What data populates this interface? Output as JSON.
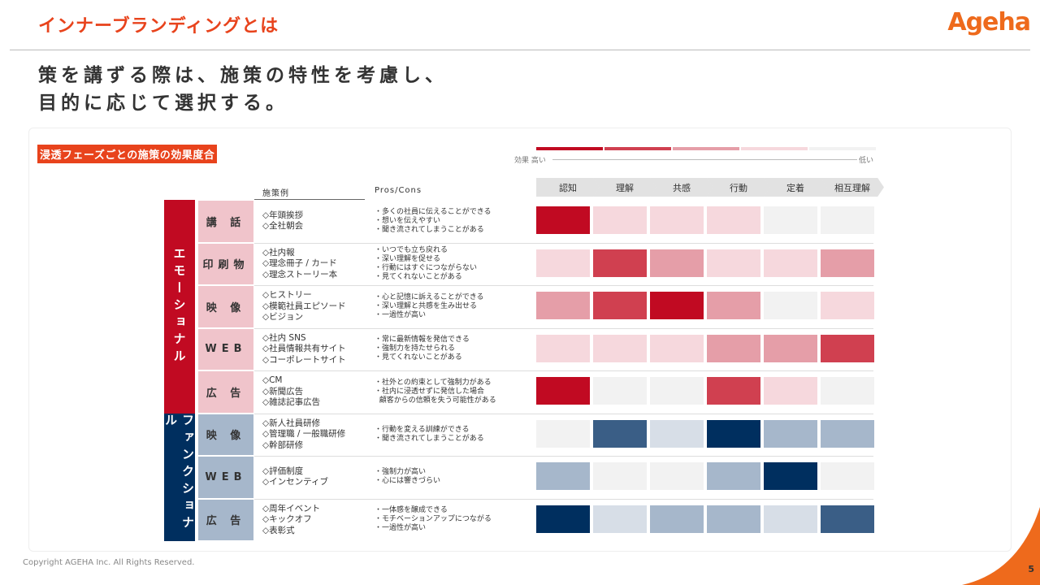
{
  "header": {
    "title": "インナーブランディングとは",
    "logo": "Ageha"
  },
  "headline": {
    "line1": "策を講ずる際は、施策の特性を考慮し、",
    "line2": "目的に応じて選択する。"
  },
  "section_tag": "浸透フェーズごとの施策の効果度合",
  "legend": {
    "high": "効果 高い",
    "low": "低い"
  },
  "columns": {
    "examples": "施策例",
    "pros": "Pros/Cons"
  },
  "phases": [
    "認知",
    "理解",
    "共感",
    "行動",
    "定着",
    "相互理解"
  ],
  "groups": [
    {
      "label": "エモーショナル"
    },
    {
      "label": "ファンクショナル"
    }
  ],
  "rows": [
    {
      "label": "講 話",
      "examples": [
        "◇年頭挨拶",
        "◇全社朝会"
      ],
      "pros": [
        "・多くの社員に伝えることができる",
        "・想いを伝えやすい",
        "・聞き流されてしまうことがある"
      ]
    },
    {
      "label": "印刷物",
      "examples": [
        "◇社内報",
        "◇理念冊子 / カード",
        "◇理念ストーリー本"
      ],
      "pros": [
        "・いつでも立ち戻れる",
        "・深い理解を促せる",
        "・行動にはすぐにつながらない",
        "・見てくれないことがある"
      ]
    },
    {
      "label": "映 像",
      "examples": [
        "◇ヒストリー",
        "◇模範社員エピソード",
        "◇ビジョン"
      ],
      "pros": [
        "・心と記憶に訴えることができる",
        "・深い理解と共感を生み出せる",
        "・一過性が高い"
      ]
    },
    {
      "label": "WEB",
      "examples": [
        "◇社内 SNS",
        "◇社員情報共有サイト",
        "◇コーポレートサイト"
      ],
      "pros": [
        "・常に最新情報を発信できる",
        "・強制力を持たせられる",
        "・見てくれないことがある"
      ]
    },
    {
      "label": "広 告",
      "examples": [
        "◇CM",
        "◇新聞広告",
        "◇雑誌記事広告"
      ],
      "pros": [
        "・社外との約束として強制力がある",
        "・社内に浸透せずに発信した場合",
        "  顧客からの信頼を失う可能性がある"
      ]
    },
    {
      "label": "映 像",
      "examples": [
        "◇新人社員研修",
        "◇管理職 / 一般職研修",
        "◇幹部研修"
      ],
      "pros": [
        "・行動を変える訓練ができる",
        "・聞き流されてしまうことがある"
      ]
    },
    {
      "label": "WEB",
      "examples": [
        "◇評価制度",
        "◇インセンティブ"
      ],
      "pros": [
        "・強制力が高い",
        "・心には響きづらい"
      ]
    },
    {
      "label": "広 告",
      "examples": [
        "◇周年イベント",
        "◇キックオフ",
        "◇表彰式"
      ],
      "pros": [
        "・一体感を醸成できる",
        "・モチベーションアップにつながる",
        "・一過性が高い"
      ]
    }
  ],
  "colors": {
    "red": [
      "#c10a22",
      "#d04050",
      "#e59ea8",
      "#f6d8dd",
      "#f2f2f2"
    ],
    "blue": [
      "#002f5f",
      "#3a5e86",
      "#a6b7cb",
      "#d7dee7",
      "#f2f2f2"
    ],
    "emotional_bar": "#c10a22",
    "functional_bar": "#002f5f",
    "emotional_label": "#f0c4cb",
    "functional_label": "#a6b7cb"
  },
  "effect_levels": [
    [
      1,
      4,
      4,
      4,
      5,
      5
    ],
    [
      4,
      2,
      3,
      4,
      4,
      3
    ],
    [
      3,
      2,
      1,
      3,
      5,
      4
    ],
    [
      4,
      4,
      4,
      3,
      3,
      2
    ],
    [
      1,
      5,
      5,
      2,
      4,
      5
    ],
    [
      5,
      2,
      4,
      1,
      3,
      3
    ],
    [
      3,
      5,
      5,
      3,
      1,
      5
    ],
    [
      1,
      4,
      3,
      3,
      4,
      2
    ]
  ],
  "footer": "Copyright AGEHA Inc. All Rights Reserved.",
  "page_number": "5"
}
